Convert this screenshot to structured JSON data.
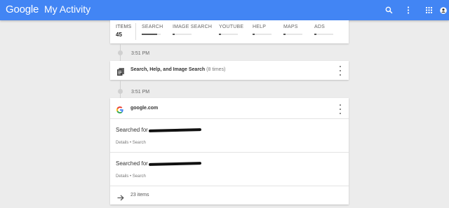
{
  "header": {
    "logo": "Google",
    "title": "My Activity",
    "background": "#4285f4",
    "icons": [
      "search-icon",
      "more-vert-icon",
      "apps-icon",
      "account-icon"
    ]
  },
  "summary": {
    "items_label": "ITEMS",
    "items_count": "45",
    "categories": [
      {
        "label": "SEARCH",
        "level": 0.8
      },
      {
        "label": "IMAGE SEARCH",
        "level": 0.1
      },
      {
        "label": "YOUTUBE",
        "level": 0.1
      },
      {
        "label": "HELP",
        "level": 0.1
      },
      {
        "label": "MAPS",
        "level": 0.1
      },
      {
        "label": "ADS",
        "level": 0.1
      }
    ]
  },
  "timeline": {
    "time1": "3:51 PM",
    "time2": "3:51 PM"
  },
  "bundle": {
    "title": "Search, Help, and Image Search",
    "count": "(8 times)",
    "icon": "document-icon"
  },
  "google_card": {
    "title": "google.com",
    "icon": "google-g-icon",
    "entries": [
      {
        "action": "Searched for",
        "meta": "Details • Search"
      },
      {
        "action": "Searched for",
        "meta": "Details • Search"
      }
    ],
    "more_label": "23 items",
    "more_icon": "arrow-right-icon"
  }
}
